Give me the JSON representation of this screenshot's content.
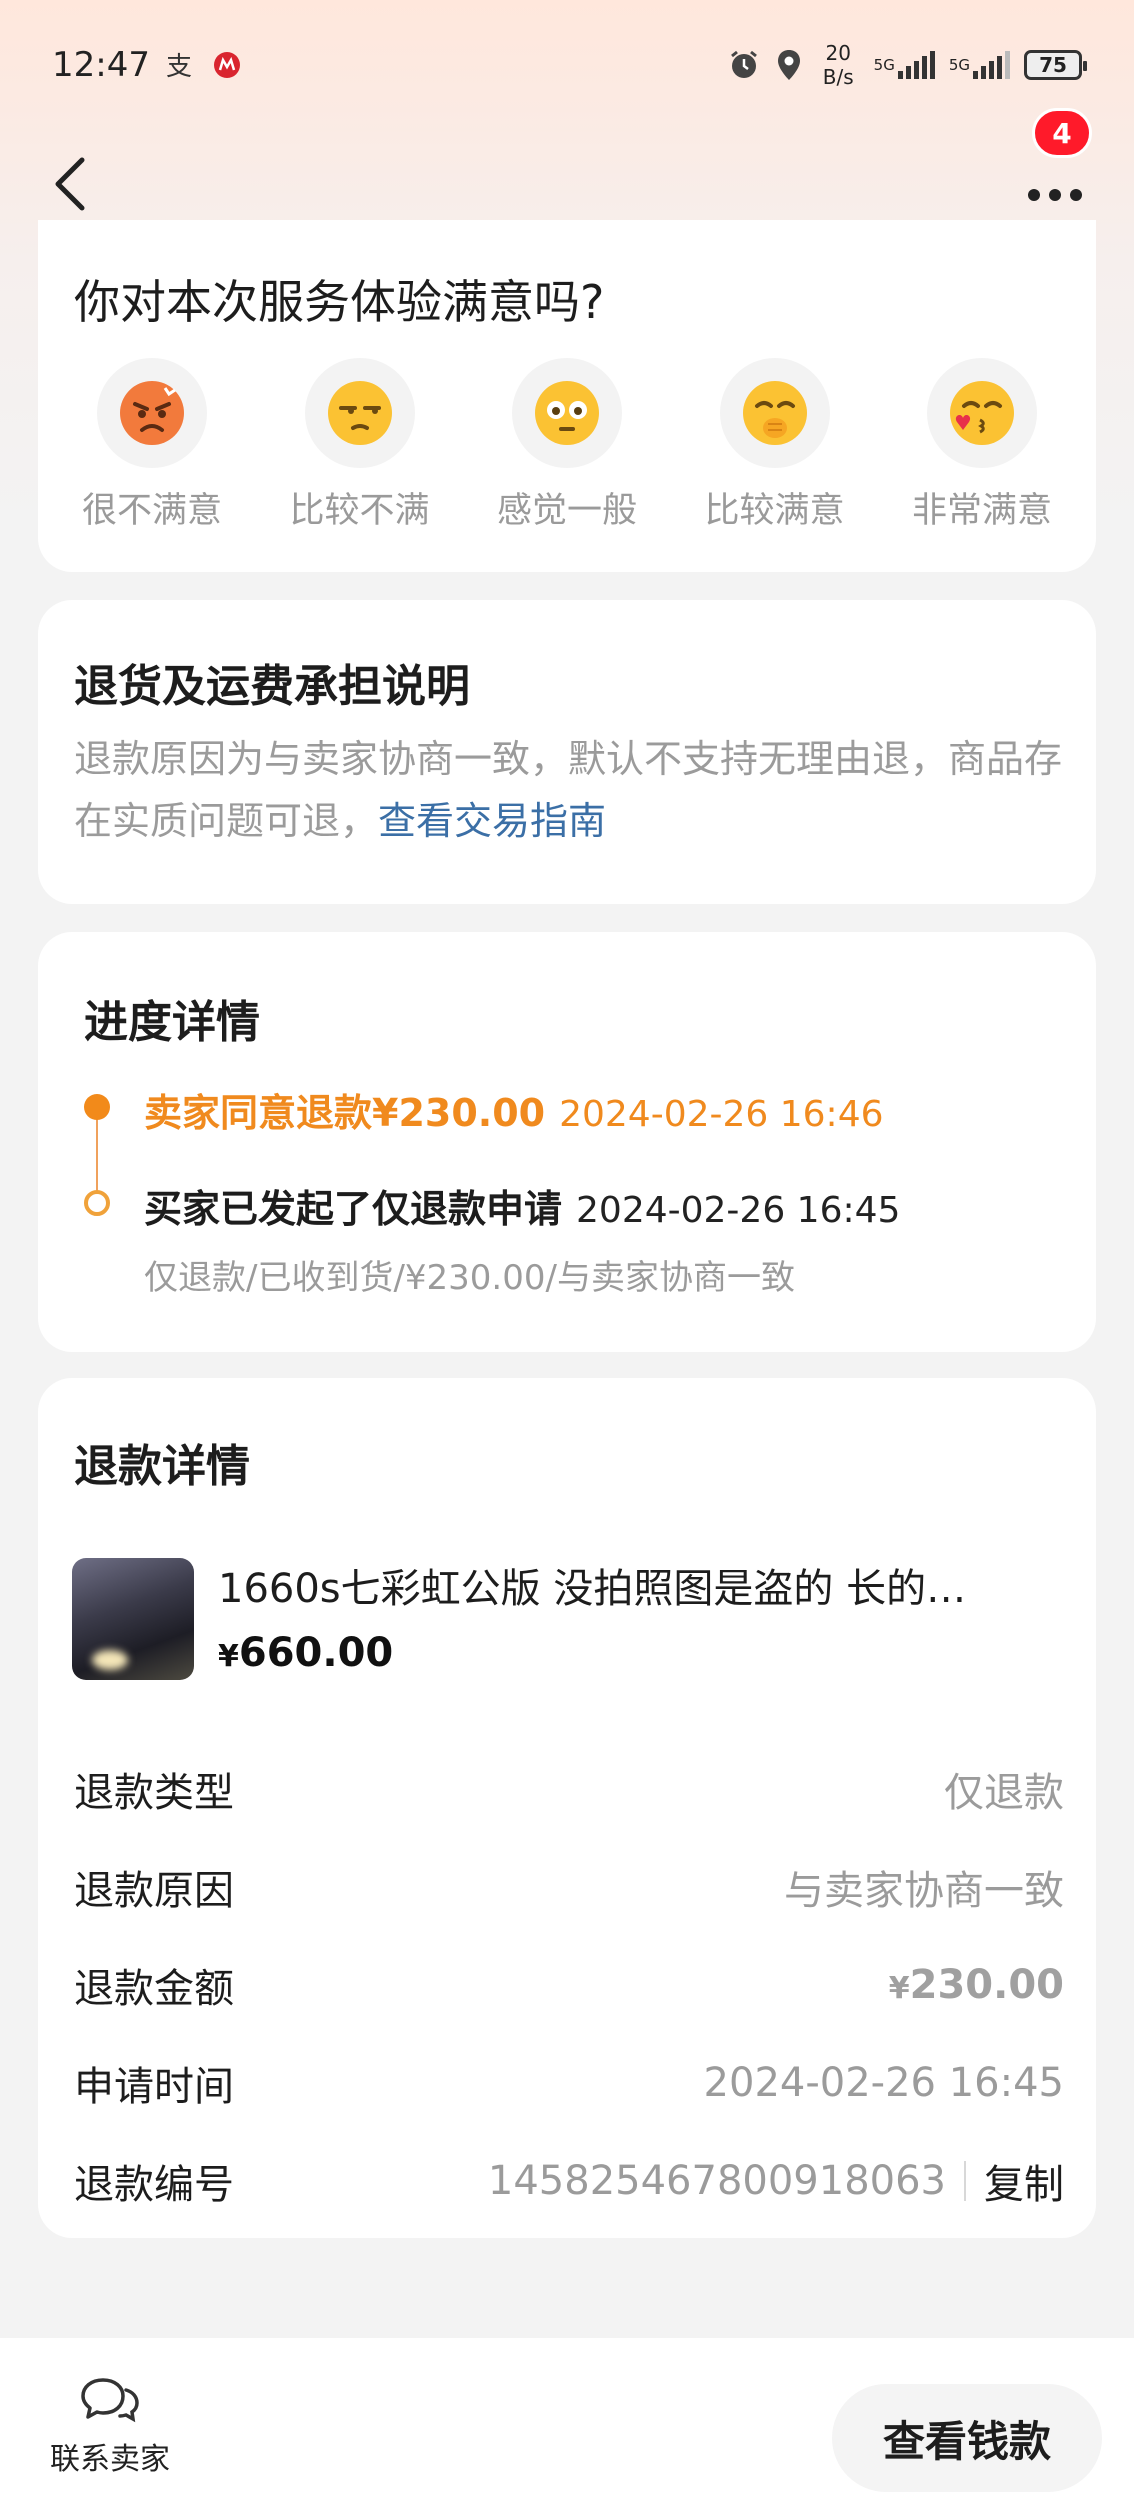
{
  "status_bar": {
    "time": "12:47",
    "net_speed_value": "20",
    "net_speed_unit": "B/s",
    "sim1": "5G",
    "sim2": "5G",
    "battery": "75"
  },
  "nav": {
    "badge_count": "4"
  },
  "satisfaction": {
    "title": "你对本次服务体验满意吗?",
    "options": [
      {
        "label": "很不满意",
        "icon": "angry-emoji-icon"
      },
      {
        "label": "比较不满",
        "icon": "unamused-emoji-icon"
      },
      {
        "label": "感觉一般",
        "icon": "neutral-emoji-icon"
      },
      {
        "label": "比较满意",
        "icon": "blushing-emoji-icon"
      },
      {
        "label": "非常满意",
        "icon": "kissing-heart-emoji-icon"
      }
    ]
  },
  "return_note": {
    "title": "退货及运费承担说明",
    "text": "退款原因为与卖家协商一致，默认不支持无理由退，商品存在实质问题可退，",
    "link": "查看交易指南"
  },
  "progress": {
    "title": "进度详情",
    "events": [
      {
        "text": "卖家同意退款¥230.00",
        "time": "2024-02-26 16:46"
      },
      {
        "text": "买家已发起了仅退款申请",
        "time": "2024-02-26 16:45",
        "sub": "仅退款/已收到货/¥230.00/与卖家协商一致"
      }
    ]
  },
  "refund": {
    "title": "退款详情",
    "product": {
      "title": "1660s七彩虹公版  没拍照图是盗的 长的…",
      "currency": "¥",
      "price": "660.00"
    },
    "rows": {
      "type_label": "退款类型",
      "type_value": "仅退款",
      "reason_label": "退款原因",
      "reason_value": "与卖家协商一致",
      "amount_label": "退款金额",
      "amount_currency": "¥",
      "amount_value": "230.00",
      "time_label": "申请时间",
      "time_value": "2024-02-26 16:45",
      "id_label": "退款编号",
      "id_value": "145825467800918063",
      "copy_label": "复制"
    }
  },
  "bottom": {
    "contact_label": "联系卖家",
    "wallet_label": "查看钱款"
  },
  "colors": {
    "accent_orange": "#f08a1e",
    "link_blue": "#3b6fa6",
    "badge_red": "#ff1a2a"
  }
}
